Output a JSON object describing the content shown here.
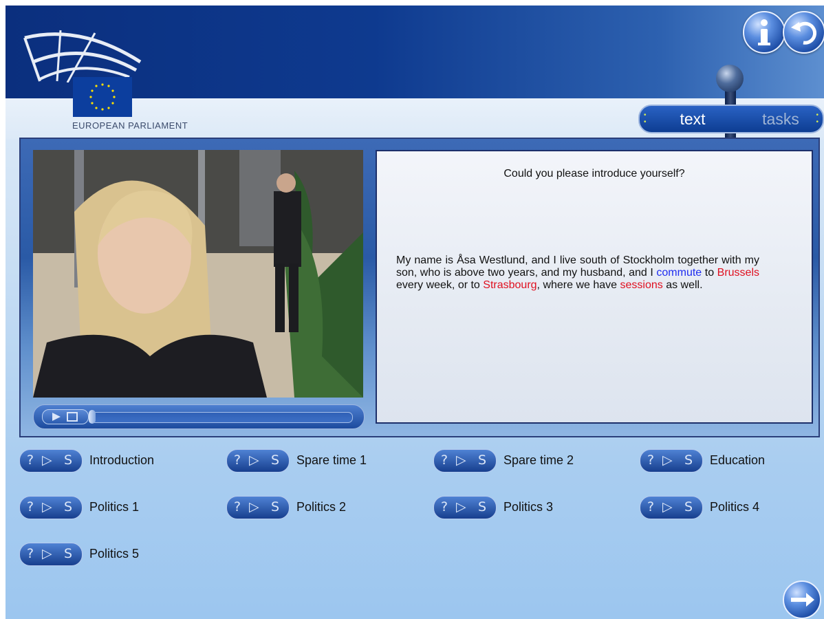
{
  "header": {
    "org_name": "EUROPEAN PARLIAMENT",
    "info_icon": "info-icon",
    "back_icon": "return-icon"
  },
  "view_toggle": {
    "options": [
      "text",
      "tasks"
    ],
    "selected": "text"
  },
  "player": {
    "controls_icons": [
      "play-icon",
      "pause-icon"
    ],
    "progress": 0.0
  },
  "text_panel": {
    "question": "Could you please introduce yourself?",
    "answer_parts": [
      "My name is Åsa Westlund, and I live south of Stockholm together with my son, who is above two years, and my husband, and I ",
      "commute",
      " to ",
      "Brussels",
      " every week, or to ",
      "Strasbourg",
      ", where we have ",
      "sessions",
      " as well."
    ],
    "highlight_colors": {
      "blue": "#1f2cf0",
      "red": "#e01020"
    }
  },
  "topics": {
    "button_glyphs": [
      "?",
      "▷",
      "S"
    ],
    "items": [
      {
        "label": "Introduction"
      },
      {
        "label": "Spare time 1"
      },
      {
        "label": "Spare time 2"
      },
      {
        "label": "Education"
      },
      {
        "label": "Politics 1"
      },
      {
        "label": "Politics 2"
      },
      {
        "label": "Politics 3"
      },
      {
        "label": "Politics 4"
      },
      {
        "label": "Politics 5"
      }
    ]
  },
  "nav": {
    "next_icon": "arrow-right-icon"
  },
  "colors": {
    "header_dark": "#0b2f7e",
    "accent": "#1f4fa8"
  }
}
